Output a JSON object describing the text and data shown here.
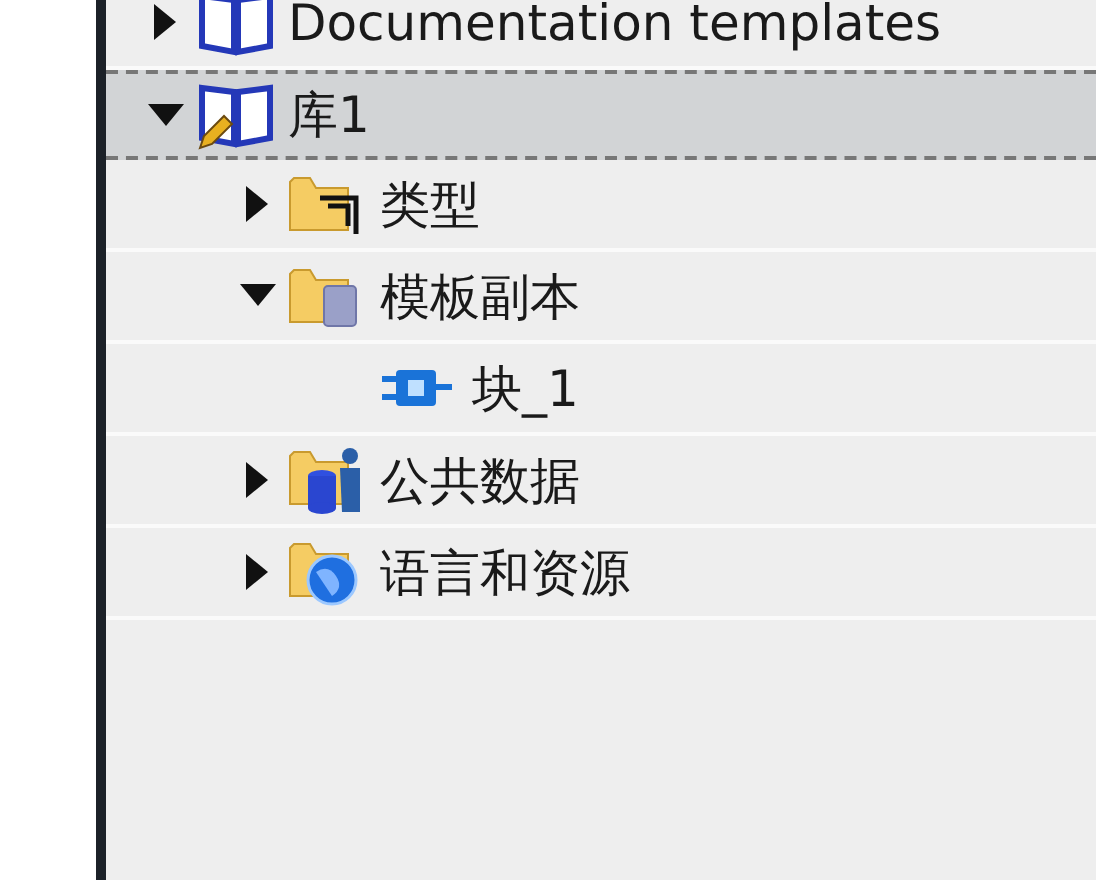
{
  "project_tree": [
    {
      "label": "Documentation templates",
      "kind": "library",
      "expanded": false,
      "selected": false
    },
    {
      "label": "库1",
      "kind": "library-edit",
      "expanded": true,
      "selected": true,
      "children": [
        {
          "label": "类型",
          "kind": "folder-types",
          "expanded": false,
          "selected": false
        },
        {
          "label": "模板副本",
          "kind": "folder-copies",
          "expanded": true,
          "selected": false,
          "children": [
            {
              "label": "块_1",
              "kind": "block",
              "selected": false
            }
          ]
        },
        {
          "label": "公共数据",
          "kind": "folder-data",
          "expanded": false,
          "selected": false
        },
        {
          "label": "语言和资源",
          "kind": "folder-resources",
          "expanded": false,
          "selected": false
        }
      ]
    }
  ]
}
